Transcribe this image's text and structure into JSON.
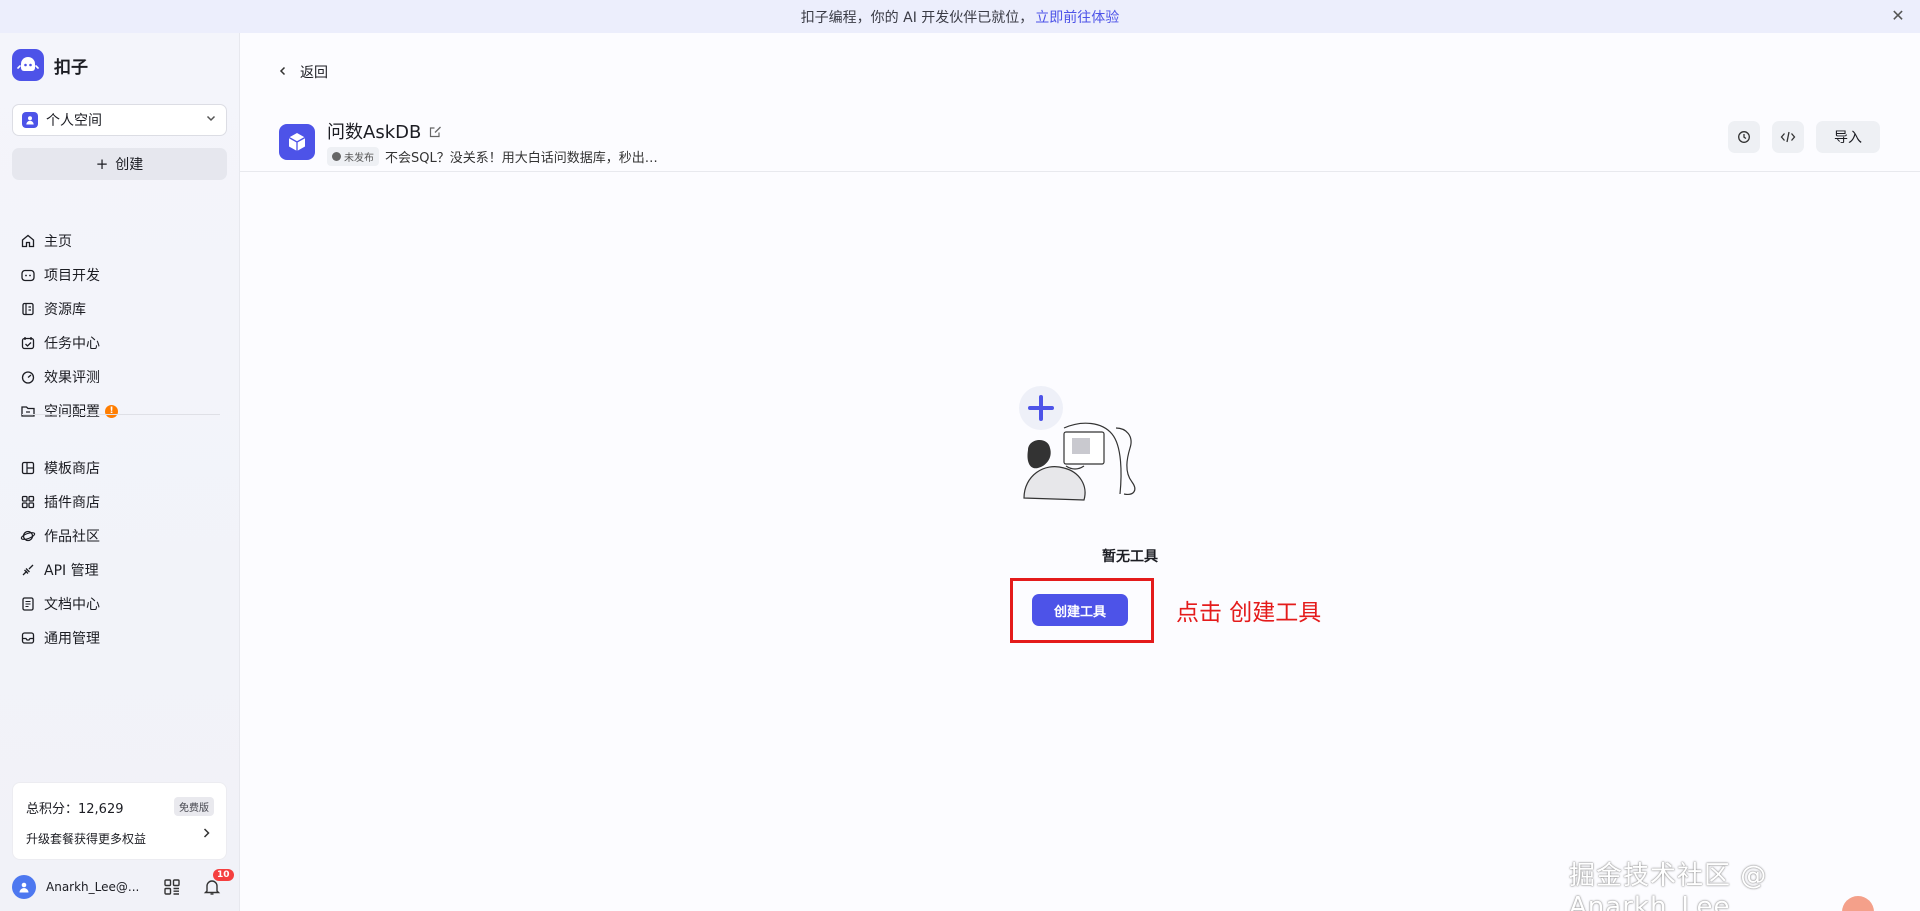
{
  "banner": {
    "text": "扣子编程，你的 AI 开发伙伴已就位，",
    "link": "立即前往体验",
    "close_icon": "close-icon"
  },
  "sidebar": {
    "brand": "扣子",
    "space": "个人空间",
    "create": "创建",
    "nav_primary": [
      {
        "label": "主页",
        "icon": "home-icon"
      },
      {
        "label": "项目开发",
        "icon": "robot-icon"
      },
      {
        "label": "资源库",
        "icon": "library-icon"
      },
      {
        "label": "任务中心",
        "icon": "task-icon"
      },
      {
        "label": "效果评测",
        "icon": "gauge-icon"
      },
      {
        "label": "空间配置",
        "icon": "folder-settings-icon",
        "badge": "!"
      }
    ],
    "nav_secondary": [
      {
        "label": "模板商店",
        "icon": "template-icon"
      },
      {
        "label": "插件商店",
        "icon": "plugin-icon"
      },
      {
        "label": "作品社区",
        "icon": "planet-icon"
      },
      {
        "label": "API 管理",
        "icon": "api-icon"
      },
      {
        "label": "文档中心",
        "icon": "document-icon"
      },
      {
        "label": "通用管理",
        "icon": "inbox-icon"
      }
    ],
    "points": {
      "label": "总积分：12,629",
      "plan": "免费版",
      "upgrade": "升级套餐获得更多权益"
    },
    "user": {
      "name": "Anarkh_Lee@...",
      "notifications": "10"
    }
  },
  "main": {
    "back": "返回",
    "tool": {
      "title": "问数AskDB",
      "status": "未发布",
      "description": "不会SQL？没关系！用大白话问数据库，秒出…"
    },
    "actions": {
      "history_icon": "history-icon",
      "code_icon": "code-icon",
      "import": "导入"
    },
    "empty": {
      "title": "暂无工具",
      "button": "创建工具"
    },
    "annotation": "点击 创建工具",
    "watermark": "掘金技术社区 @ Anarkh_Lee"
  },
  "colors": {
    "accent": "#4d53e8",
    "annotation_red": "#e41b1b",
    "banner_bg": "#eceefc"
  }
}
